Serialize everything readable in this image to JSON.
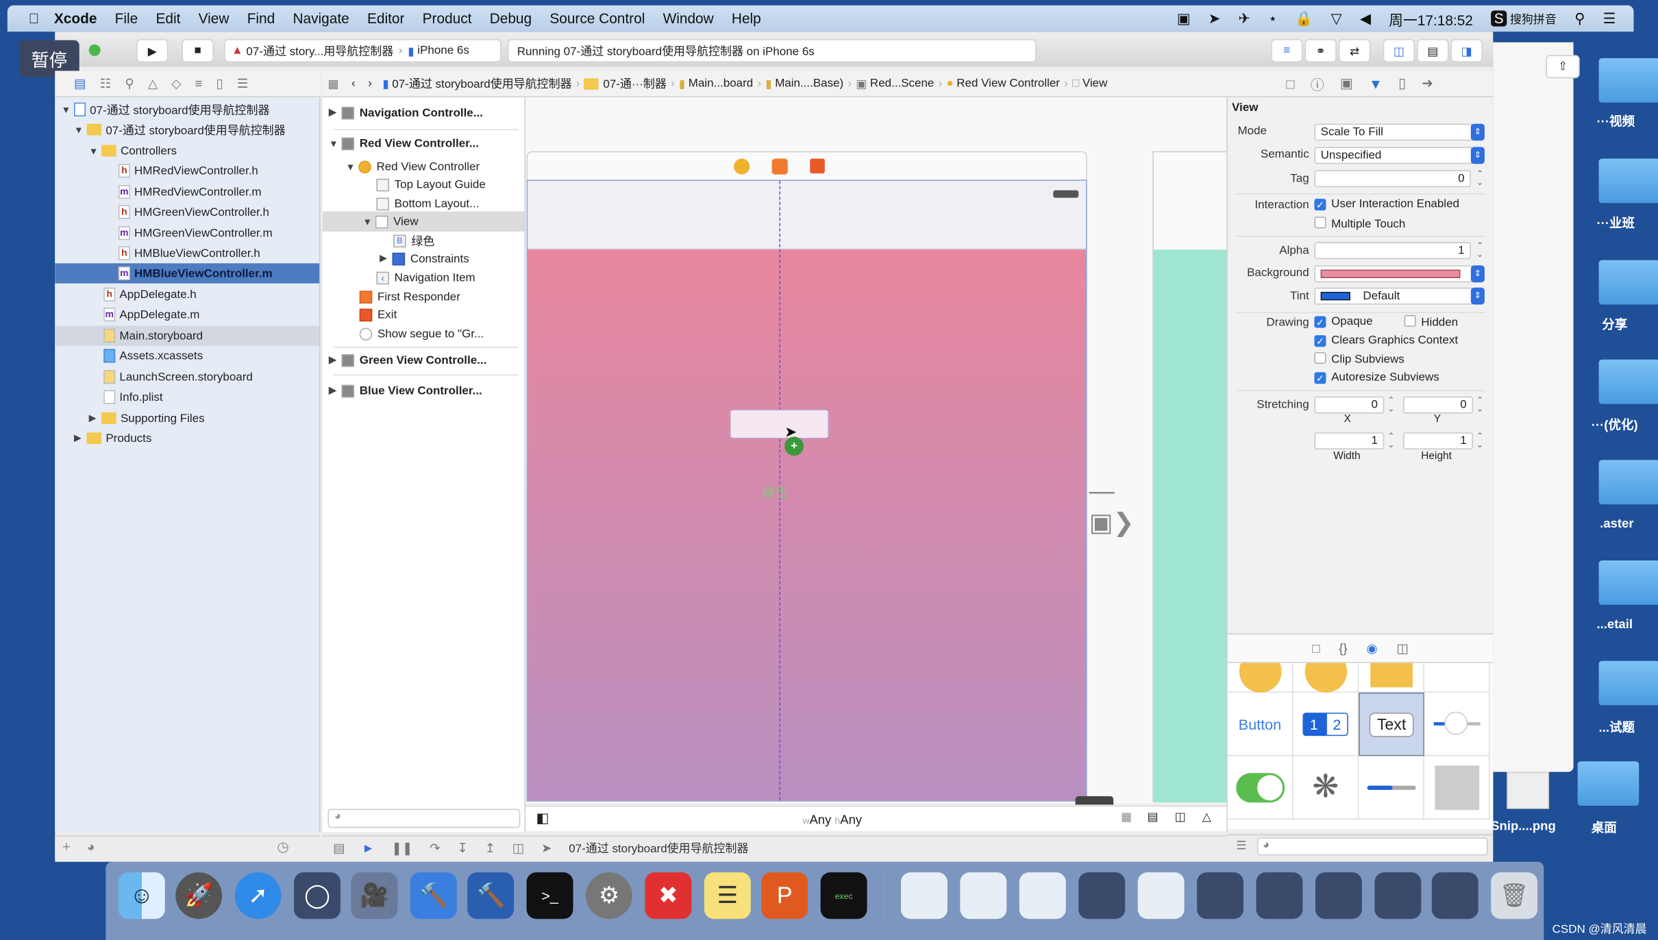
{
  "menubar": {
    "app": "Xcode",
    "items": [
      "File",
      "Edit",
      "View",
      "Find",
      "Navigate",
      "Editor",
      "Product",
      "Debug",
      "Source Control",
      "Window",
      "Help"
    ],
    "clock": "周一17:18:52",
    "ime": "搜狗拼音",
    "status_icons": [
      "screen-record-icon",
      "location-icon",
      "airplane-icon",
      "bluetooth-icon",
      "lock-icon",
      "wifi-icon",
      "volume-icon"
    ]
  },
  "overlay": {
    "pause_badge": "暂停"
  },
  "toolbar": {
    "scheme": "07-通过 story...用导航控制器",
    "device": "iPhone 6s",
    "status": "Running 07-通过 storyboard使用导航控制器 on iPhone 6s"
  },
  "jumpbar": {
    "crumbs": [
      "07-通过 storyboard使用导航控制器",
      "07-通···制器",
      "Main...board",
      "Main....Base)",
      "Red...Scene",
      "Red View Controller",
      "View"
    ]
  },
  "navigator": {
    "items": [
      {
        "label": "07-通过 storyboard使用导航控制器",
        "type": "project"
      },
      {
        "label": "07-通过 storyboard使用导航控制器",
        "type": "folder"
      },
      {
        "label": "Controllers",
        "type": "folder"
      },
      {
        "label": "HMRedViewController.h",
        "type": "h"
      },
      {
        "label": "HMRedViewController.m",
        "type": "m"
      },
      {
        "label": "HMGreenViewController.h",
        "type": "h"
      },
      {
        "label": "HMGreenViewController.m",
        "type": "m"
      },
      {
        "label": "HMBlueViewController.h",
        "type": "h"
      },
      {
        "label": "HMBlueViewController.m",
        "type": "m",
        "selected": true
      },
      {
        "label": "AppDelegate.h",
        "type": "h"
      },
      {
        "label": "AppDelegate.m",
        "type": "m"
      },
      {
        "label": "Main.storyboard",
        "type": "storyboard",
        "highlighted": true
      },
      {
        "label": "Assets.xcassets",
        "type": "assets"
      },
      {
        "label": "LaunchScreen.storyboard",
        "type": "storyboard"
      },
      {
        "label": "Info.plist",
        "type": "plist"
      },
      {
        "label": "Supporting Files",
        "type": "folder"
      },
      {
        "label": "Products",
        "type": "folder"
      }
    ]
  },
  "outline": {
    "items": [
      {
        "label": "Navigation Controlle..."
      },
      {
        "label": "Red View Controller..."
      },
      {
        "label": "Red View Controller"
      },
      {
        "label": "Top Layout Guide"
      },
      {
        "label": "Bottom Layout..."
      },
      {
        "label": "View",
        "selected": true
      },
      {
        "label": "绿色"
      },
      {
        "label": "Constraints"
      },
      {
        "label": "Navigation Item"
      },
      {
        "label": "First Responder"
      },
      {
        "label": "Exit"
      },
      {
        "label": "Show segue to \"Gr..."
      },
      {
        "label": "Green View Controlle..."
      },
      {
        "label": "Blue View Controller..."
      }
    ]
  },
  "canvas": {
    "button_label": "绿色",
    "size_class_w": "w",
    "size_class_any_w": "Any",
    "size_class_h": "h",
    "size_class_any_h": "Any",
    "colors": {
      "top": "#e8879e",
      "bottom": "#b98fc0",
      "green_scene": "#9fe6d2"
    }
  },
  "debugbar": {
    "target": "07-通过 storyboard使用导航控制器"
  },
  "inspector": {
    "section": "View",
    "mode_label": "Mode",
    "mode_value": "Scale To Fill",
    "semantic_label": "Semantic",
    "semantic_value": "Unspecified",
    "tag_label": "Tag",
    "tag_value": "0",
    "interaction_label": "Interaction",
    "user_interaction": {
      "label": "User Interaction Enabled",
      "checked": true
    },
    "multiple_touch": {
      "label": "Multiple Touch",
      "checked": false
    },
    "alpha_label": "Alpha",
    "alpha_value": "1",
    "background_label": "Background",
    "background_color": "#eb8e9f",
    "tint_label": "Tint",
    "tint_value": "Default",
    "tint_color": "#1f63d8",
    "drawing_label": "Drawing",
    "opaque": {
      "label": "Opaque",
      "checked": true
    },
    "hidden": {
      "label": "Hidden",
      "checked": false
    },
    "clears": {
      "label": "Clears Graphics Context",
      "checked": true
    },
    "clip": {
      "label": "Clip Subviews",
      "checked": false
    },
    "autoresize": {
      "label": "Autoresize Subviews",
      "checked": true
    },
    "stretching_label": "Stretching",
    "stretch_x": "0",
    "stretch_y": "0",
    "stretch_w": "1",
    "stretch_h": "1",
    "x_label": "X",
    "y_label": "Y",
    "width_label": "Width",
    "height_label": "Height"
  },
  "library": {
    "button_label": "Button",
    "seg1": "1",
    "seg2": "2",
    "textfield_label": "Text"
  },
  "desktop": {
    "labels": [
      "···视频",
      "···业班",
      "分享",
      "···(优化)",
      ".aster",
      "...etail",
      "...试题",
      "桌面"
    ],
    "file_label": "Snip....png",
    "watermark": "CSDN @清风清晨"
  },
  "dock": {
    "apps": [
      "finder-icon",
      "launchpad-icon",
      "safari-icon",
      "mouse-icon",
      "photo-booth-icon",
      "xcode-icon",
      "xcode-beta-icon",
      "terminal-icon",
      "system-preferences-icon",
      "xmind-icon",
      "notes-icon",
      "powerpoint-icon",
      "exec-terminal-icon"
    ]
  }
}
